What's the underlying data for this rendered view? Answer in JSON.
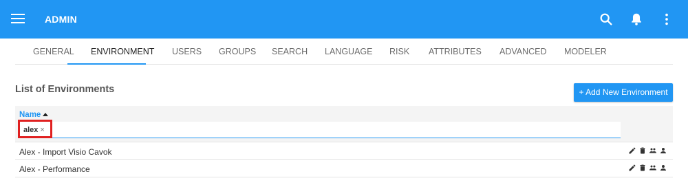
{
  "header": {
    "title": "ADMIN",
    "color": "#2196f3",
    "icons": [
      "menu-icon",
      "search-icon",
      "bell-icon",
      "more-vert-icon"
    ]
  },
  "tabs": [
    {
      "label": "GENERAL"
    },
    {
      "label": "ENVIRONMENT",
      "active": true
    },
    {
      "label": "USERS"
    },
    {
      "label": "GROUPS"
    },
    {
      "label": "SEARCH"
    },
    {
      "label": "LANGUAGE"
    },
    {
      "label": "RISK"
    },
    {
      "label": "ATTRIBUTES"
    },
    {
      "label": "ADVANCED"
    },
    {
      "label": "MODELER"
    }
  ],
  "main": {
    "section_title": "List of Environments",
    "add_button_label": "+ Add New Environment",
    "column_name": "Name",
    "filter": {
      "chip_label": "alex",
      "chip_remove": "×",
      "highlight_color": "#e02020"
    },
    "rows": [
      {
        "name": "Alex - Import Visio Cavok",
        "actions": [
          "edit-icon",
          "delete-icon",
          "group-icon",
          "user-icon"
        ]
      },
      {
        "name": "Alex - Performance",
        "actions": [
          "edit-icon",
          "delete-icon",
          "group-icon",
          "user-icon"
        ]
      }
    ]
  }
}
